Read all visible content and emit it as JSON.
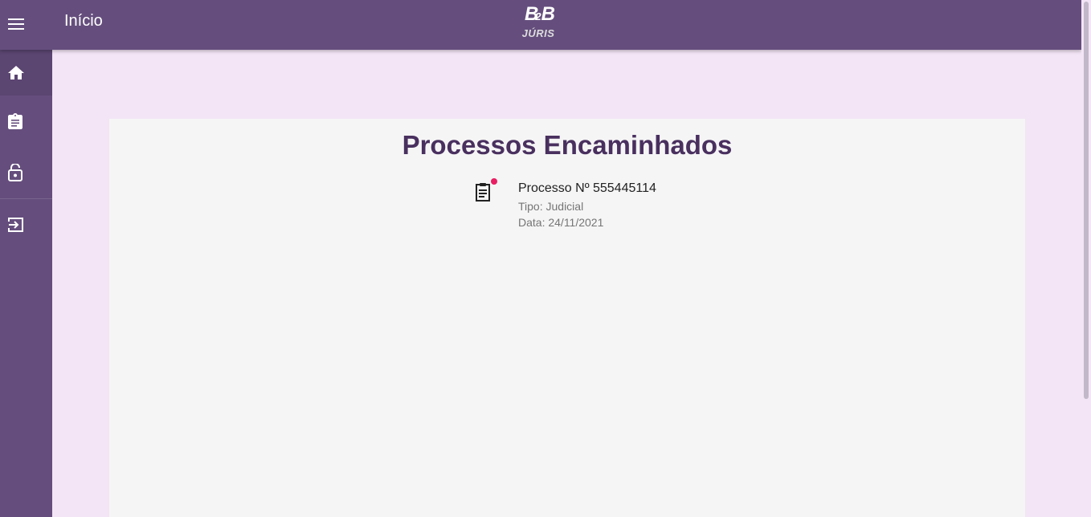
{
  "header": {
    "title": "Início",
    "logo": {
      "top": "B",
      "mid": "2",
      "bottom": "B",
      "word": "JÚRIS"
    },
    "menu_icon": "menu-icon"
  },
  "sidebar": {
    "items": [
      {
        "icon": "home-icon",
        "active": true
      },
      {
        "icon": "clipboard-icon",
        "active": false
      },
      {
        "icon": "lock-open-icon",
        "active": false
      },
      {
        "icon": "logout-icon",
        "active": false
      }
    ]
  },
  "main": {
    "title": "Processos Encaminhados",
    "processes": [
      {
        "title": "Processo Nº 555445114",
        "tipo": "Tipo: Judicial",
        "data": "Data: 24/11/2021",
        "icon": "clipboard-list-icon",
        "has_notification": true
      }
    ]
  },
  "colors": {
    "appbar": "#654e7d",
    "background": "#f3e5f5",
    "card": "#f5f5f5",
    "title": "#49305f",
    "badge": "#e91e63"
  }
}
